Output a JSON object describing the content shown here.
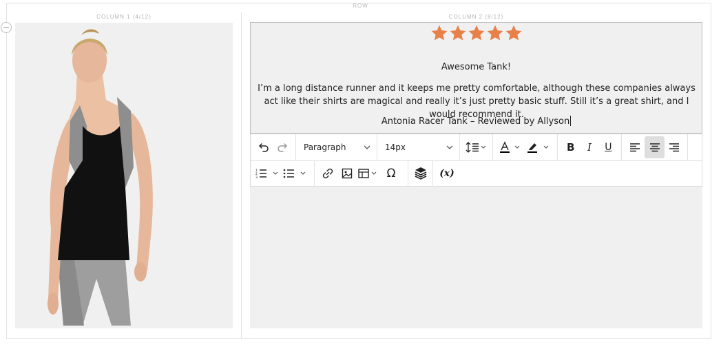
{
  "row": {
    "label": "ROW"
  },
  "columns": [
    {
      "label": "COLUMN 1 (4/12)"
    },
    {
      "label": "COLUMN 2 (8/12)"
    }
  ],
  "review": {
    "rating": 5,
    "star_color": "#e8804a",
    "title": "Awesome Tank!",
    "body": "I’m a long distance runner and it keeps me pretty comfortable, although these companies always act like their shirts are magical and really it’s just pretty basic stuff. Still it’s a great shirt, and I would recommend it.",
    "attribution": "Antonia Racer Tank – Reviewed by Allyson"
  },
  "toolbar": {
    "block_format": "Paragraph",
    "font_size": "14px",
    "active_alignment": "align-center",
    "icons": [
      "undo-icon",
      "redo-icon",
      "line-height-icon",
      "text-color-icon",
      "highlight-color-icon",
      "bold-icon",
      "italic-icon",
      "underline-icon",
      "align-left-icon",
      "align-center-icon",
      "align-right-icon",
      "numbered-list-icon",
      "bullet-list-icon",
      "link-icon",
      "image-icon",
      "table-icon",
      "special-character-icon",
      "widget-icon",
      "variable-icon"
    ]
  }
}
